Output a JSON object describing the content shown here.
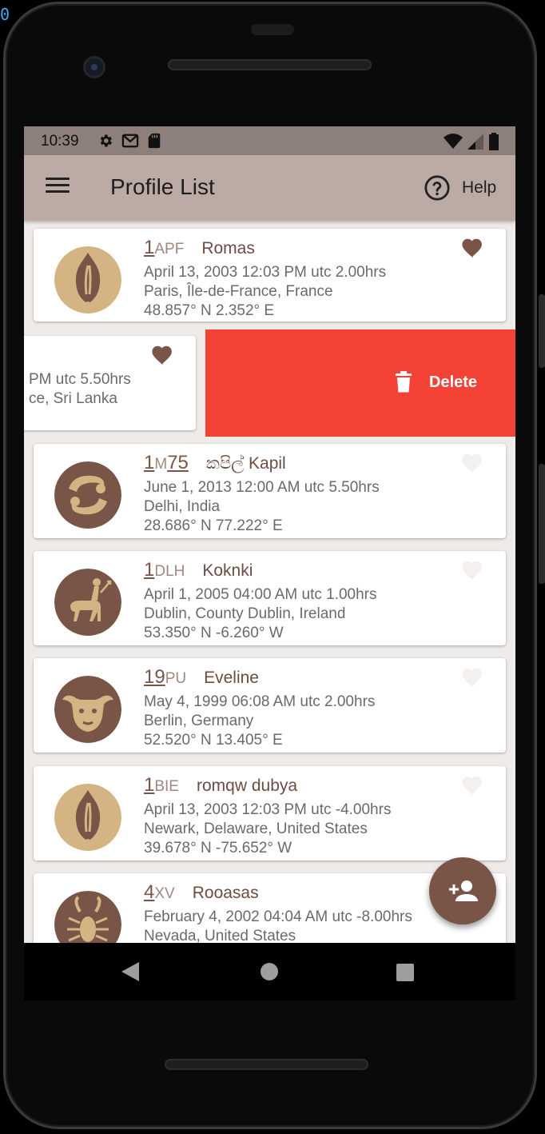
{
  "status_bar": {
    "time": "10:39"
  },
  "app_bar": {
    "title": "Profile List",
    "help_label": "Help"
  },
  "delete_action": {
    "label": "Delete"
  },
  "swiped_profile": {
    "detail_1": " PM utc 5.50hrs",
    "detail_2": "ce, Sri Lanka"
  },
  "profiles": [
    {
      "code_num": "1",
      "code_suffix": "APF",
      "name": "Romas",
      "datetime": "April 13, 2003 12:03 PM utc 2.00hrs",
      "place": "Paris, Île-de-France, France",
      "coords": "48.857° N 2.352° E",
      "favorite": true,
      "sign_icon": "gemini-sign-icon"
    },
    {
      "code_num": "1",
      "code_mid": "M",
      "code_num2": "75",
      "name": "කපිල් Kapil",
      "datetime": "June 1, 2013 12:00 AM utc 5.50hrs",
      "place": "Delhi, India",
      "coords": "28.686° N 77.222° E",
      "favorite": false,
      "sign_icon": "cancer-sign-icon"
    },
    {
      "code_num": "1",
      "code_suffix": "DLH",
      "name": "Koknki",
      "datetime": "April 1, 2005 04:00 AM utc 1.00hrs",
      "place": "Dublin, County Dublin, Ireland",
      "coords": "53.350° N -6.260° W",
      "favorite": false,
      "sign_icon": "sagittarius-sign-icon"
    },
    {
      "code_num": "19",
      "code_suffix": "PU",
      "name": "Eveline",
      "datetime": "May 4, 1999 06:08 AM utc 2.00hrs",
      "place": "Berlin, Germany",
      "coords": "52.520° N 13.405° E",
      "favorite": false,
      "sign_icon": "taurus-sign-icon"
    },
    {
      "code_num": "1",
      "code_suffix": "BIE",
      "name": "romqw dubya",
      "datetime": "April 13, 2003 12:03 PM utc -4.00hrs",
      "place": "Newark, Delaware, United States",
      "coords": "39.678° N -75.652° W",
      "favorite": false,
      "sign_icon": "gemini-sign-icon"
    },
    {
      "code_num": "4",
      "code_suffix": "XV",
      "name": "Rooasas",
      "datetime": "February 4, 2002 04:04 AM utc -8.00hrs",
      "place": "Nevada, United States",
      "coords": "",
      "favorite": false,
      "sign_icon": "scorpio-sign-icon"
    }
  ],
  "colors": {
    "primary": "#795548",
    "app_bar": "#bcaaa4",
    "delete": "#f44336",
    "avatar_light": "#d4b483",
    "avatar_dark": "#795548"
  }
}
